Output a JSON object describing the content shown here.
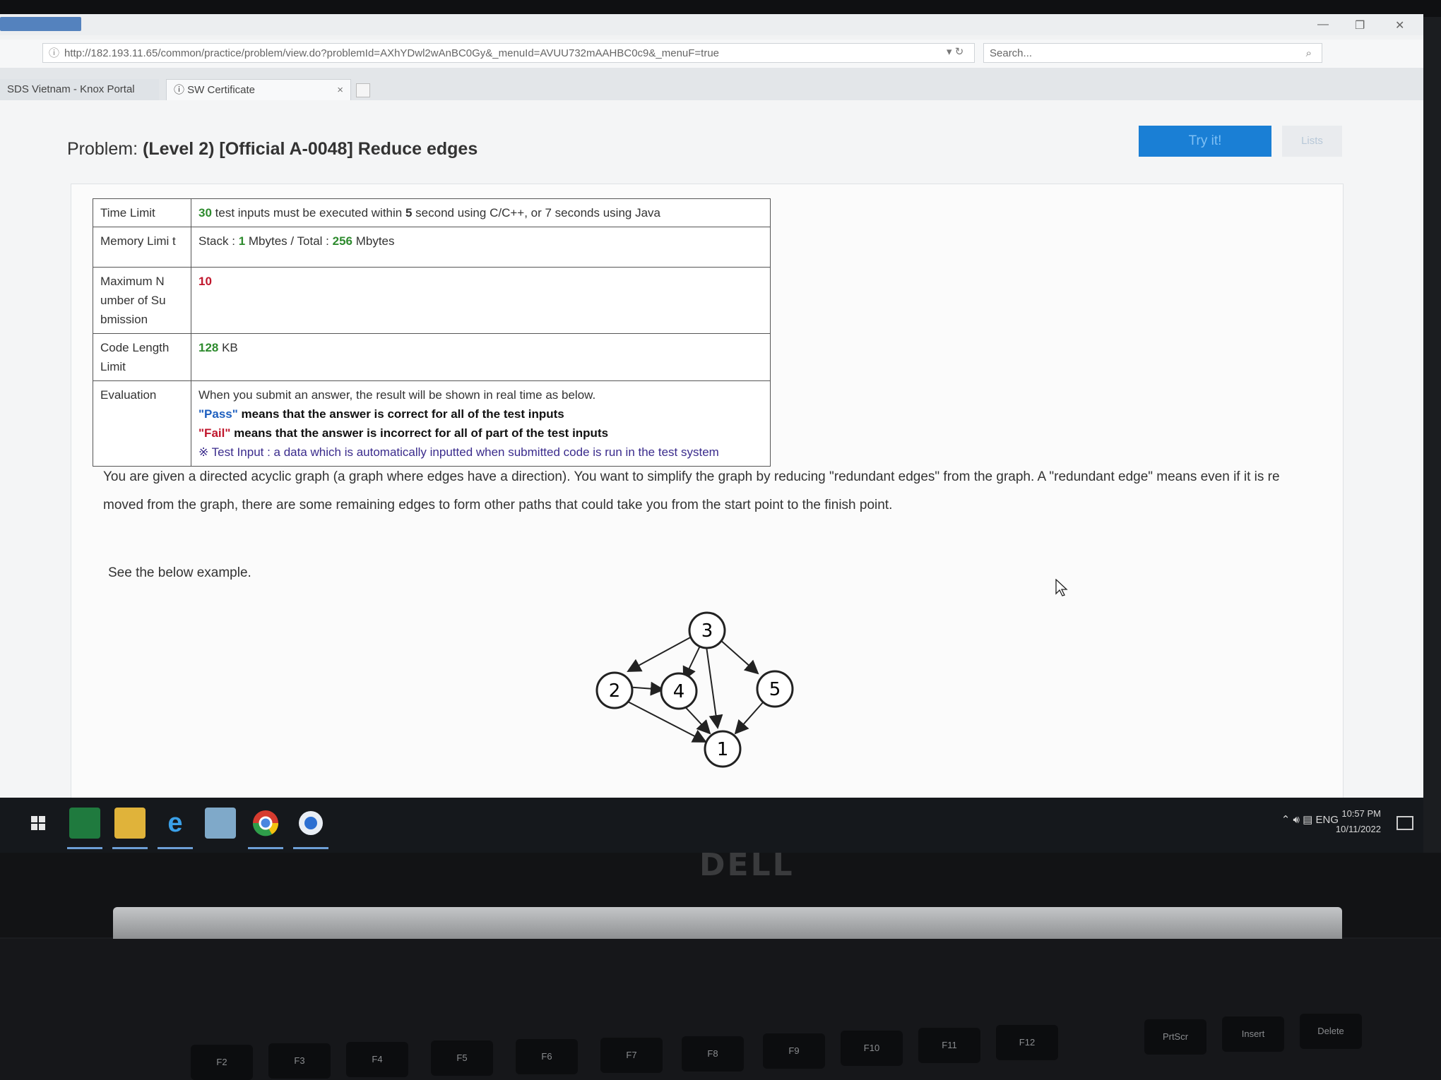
{
  "browser": {
    "url": "http://182.193.11.65/common/practice/problem/view.do?problemId=AXhYDwl2wAnBC0Gy&_menuId=AVUU732mAAHBC0c9&_menuF=true",
    "search_placeholder": "Search...",
    "tabs": [
      {
        "label": "SDS Vietnam - Knox Portal"
      },
      {
        "label": "SW Certificate"
      }
    ],
    "tab_close": "×"
  },
  "page": {
    "title_prefix": "Problem:",
    "title_main": "(Level 2) [Official A-0048] Reduce edges",
    "try_button": "Try it!",
    "list_button": "Lists"
  },
  "info": {
    "time_limit": {
      "label": "Time Limit",
      "count": "30",
      "text1": " test inputs must be executed within ",
      "seconds": "5",
      "text2": " second using C/C++, or ",
      "java_seconds": "7",
      "text3": " seconds using Java"
    },
    "memory_limit": {
      "label": "Memory Limi t",
      "stack_label": "Stack : ",
      "stack_value": "1",
      "stack_unit": " Mbytes  /  Total : ",
      "total_value": "256",
      "total_unit": " Mbytes"
    },
    "max_submission": {
      "label": "Maximum N umber of Su bmission",
      "value": "10"
    },
    "code_length": {
      "label": "Code Length Limit",
      "value": "128",
      "unit": " KB"
    },
    "evaluation": {
      "label": "Evaluation",
      "line1": "When you submit an answer, the result will be shown in real time as below.",
      "pass_word": "\"Pass\"",
      "pass_text": " means that the answer is correct for all of the test inputs",
      "fail_word": "\"Fail\"",
      "fail_text": " means that the answer is incorrect for all of part of the test inputs",
      "note": "※ Test Input : a data which is automatically inputted when submitted code is run in the test system"
    }
  },
  "description": {
    "paragraph": "You are given a directed acyclic graph (a graph where edges have a direction). You want to simplify the graph by reducing \"redundant edges\" from the graph. A \"redundant edge\" means even if it is re moved from the graph, there are some remaining edges to form other paths that could take you from the start point to the finish point.",
    "see_below": "See the below example."
  },
  "graph": {
    "nodes": [
      "1",
      "2",
      "3",
      "4",
      "5"
    ],
    "edges": [
      [
        "3",
        "2"
      ],
      [
        "3",
        "4"
      ],
      [
        "3",
        "1"
      ],
      [
        "3",
        "5"
      ],
      [
        "2",
        "4"
      ],
      [
        "2",
        "1"
      ],
      [
        "4",
        "1"
      ],
      [
        "5",
        "1"
      ]
    ]
  },
  "taskbar": {
    "tray_lang": "ENG",
    "time": "10:57 PM",
    "date": "10/11/2022"
  },
  "hardware": {
    "brand": "DELL",
    "keys": [
      "F2",
      "F3",
      "F4",
      "F5",
      "F6",
      "F7",
      "F8",
      "F9",
      "F10",
      "F11",
      "F12",
      "PrtScr",
      "Insert",
      "Delete"
    ]
  }
}
